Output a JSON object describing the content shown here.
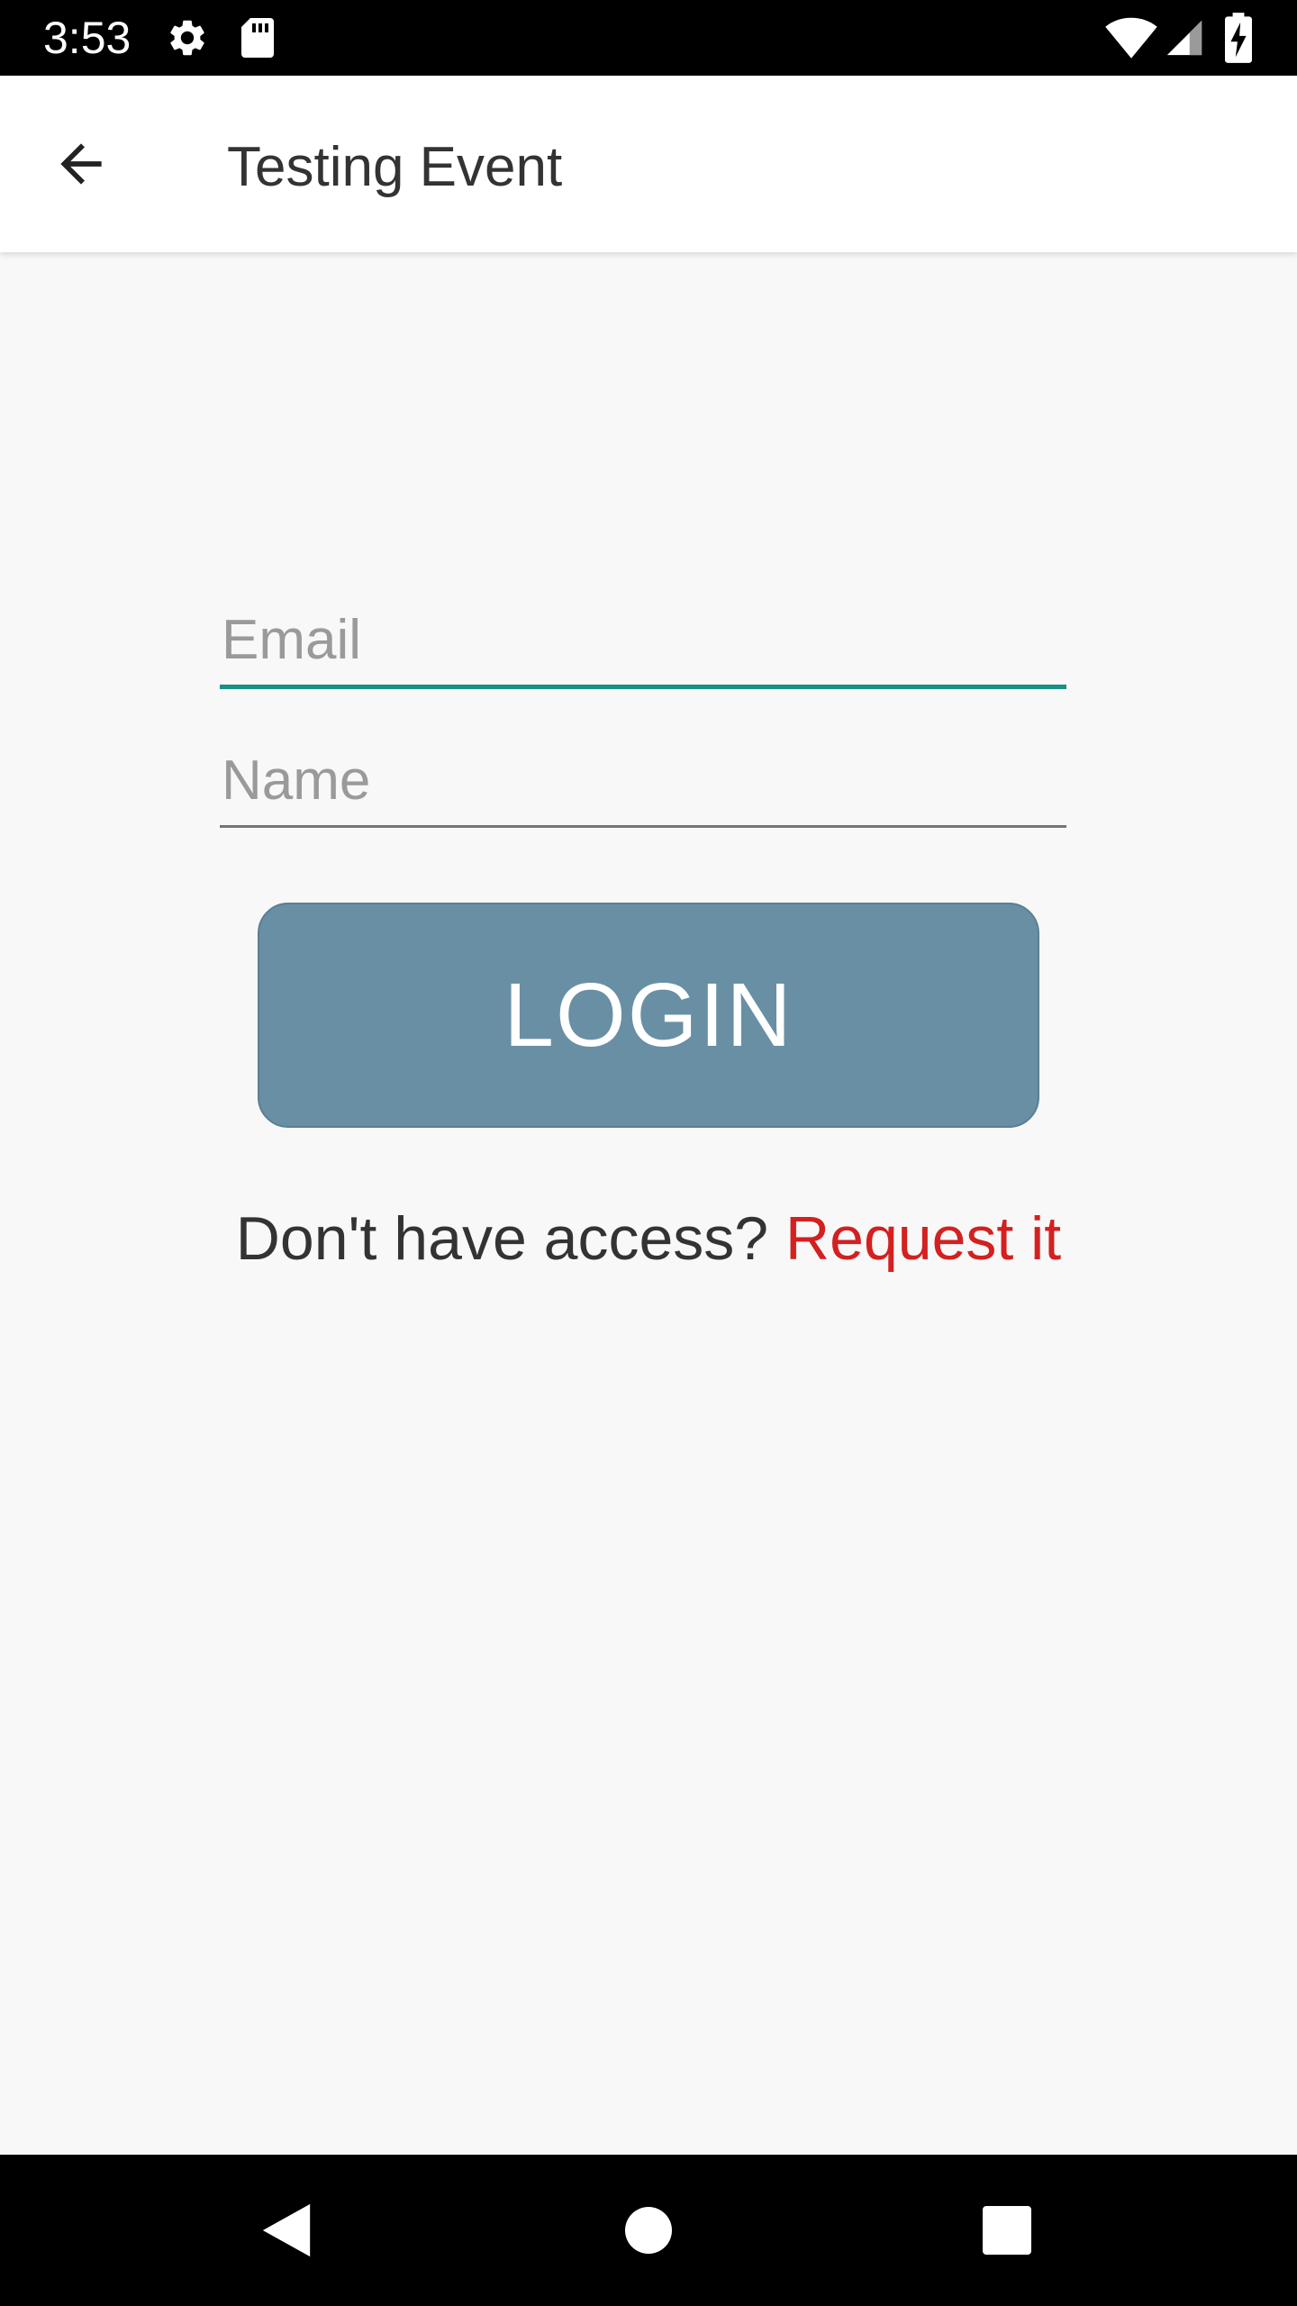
{
  "status_bar": {
    "time": "3:53",
    "icons": [
      "gear-icon",
      "sd-card-icon",
      "wifi-icon",
      "cell-signal-icon",
      "battery-charging-icon"
    ]
  },
  "app_bar": {
    "title": "Testing Event",
    "back_icon": "arrow-left-icon"
  },
  "form": {
    "email": {
      "placeholder": "Email",
      "value": ""
    },
    "name": {
      "placeholder": "Name",
      "value": ""
    },
    "login_label": "LOGIN",
    "access_text": "Don't have access? ",
    "request_link": "Request it"
  },
  "nav_bar": {
    "icons": [
      "nav-back-icon",
      "nav-home-icon",
      "nav-recents-icon"
    ]
  },
  "colors": {
    "accent": "#179085",
    "button": "#698fa4",
    "link": "#d32020",
    "background": "#f8f8f8"
  }
}
